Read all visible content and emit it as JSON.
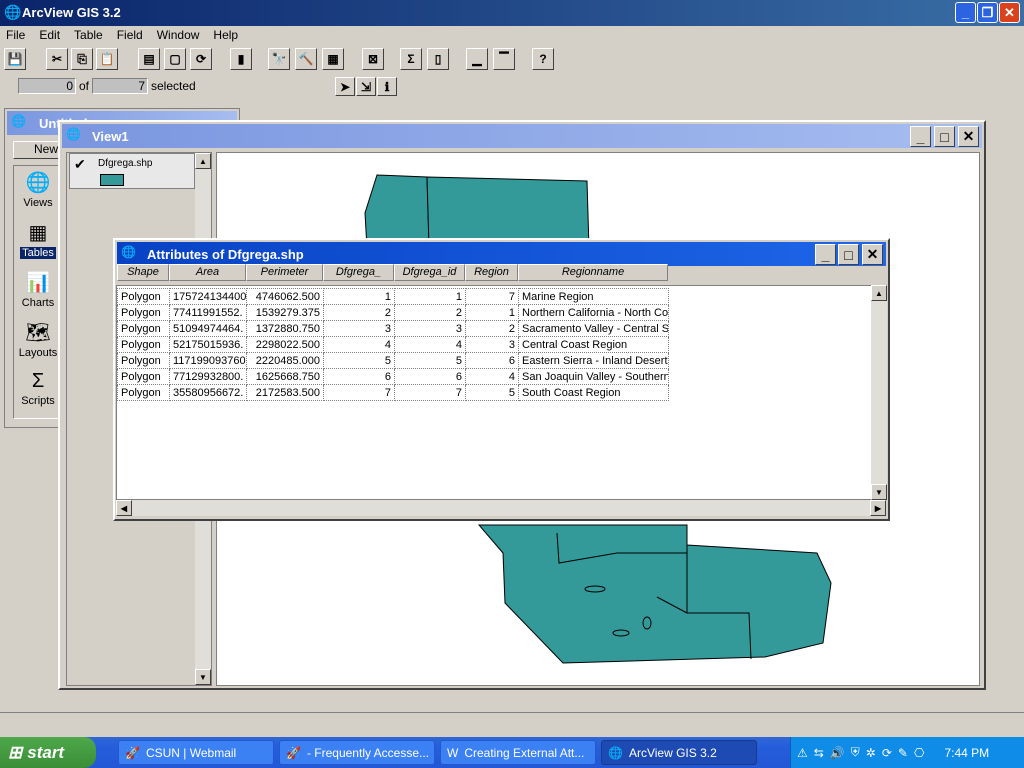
{
  "app": {
    "title": "ArcView GIS 3.2"
  },
  "menu": [
    "File",
    "Edit",
    "Table",
    "Field",
    "Window",
    "Help"
  ],
  "selection": {
    "count": "0",
    "of": "of",
    "total": "7",
    "selected": "selected"
  },
  "project": {
    "title": "Untitled",
    "new_label": "New",
    "items": [
      "Views",
      "Tables",
      "Charts",
      "Layouts",
      "Scripts"
    ]
  },
  "view1": {
    "title": "View1",
    "layer": "Dfgrega.shp",
    "fill": "#339999"
  },
  "attr": {
    "title": "Attributes of Dfgrega.shp",
    "columns": [
      "Shape",
      "Area",
      "Perimeter",
      "Dfgrega_",
      "Dfgrega_id",
      "Region",
      "Regionname"
    ],
    "rows": [
      [
        "Polygon",
        "175724134400",
        "4746062.500",
        "1",
        "1",
        "7",
        "Marine Region"
      ],
      [
        "Polygon",
        "77411991552.",
        "1539279.375",
        "2",
        "2",
        "1",
        "Northern California - North Coa"
      ],
      [
        "Polygon",
        "51094974464.",
        "1372880.750",
        "3",
        "3",
        "2",
        "Sacramento Valley - Central Sie"
      ],
      [
        "Polygon",
        "52175015936.",
        "2298022.500",
        "4",
        "4",
        "3",
        "Central Coast Region"
      ],
      [
        "Polygon",
        "117199093760",
        "2220485.000",
        "5",
        "5",
        "6",
        "Eastern Sierra - Inland Deserts"
      ],
      [
        "Polygon",
        "77129932800.",
        "1625668.750",
        "6",
        "6",
        "4",
        "San Joaquin Valley - Southern"
      ],
      [
        "Polygon",
        "35580956672.",
        "2172583.500",
        "7",
        "7",
        "5",
        "South Coast Region"
      ]
    ]
  },
  "taskbar": {
    "start": "start",
    "tasks": [
      "CSUN | Webmail",
      "- Frequently Accesse...",
      "Creating External Att...",
      "ArcView GIS 3.2"
    ],
    "clock": "7:44 PM"
  },
  "colors": {
    "map_fill": "#339999",
    "title_active": "#0a246a",
    "taskbar": "#245edb"
  }
}
